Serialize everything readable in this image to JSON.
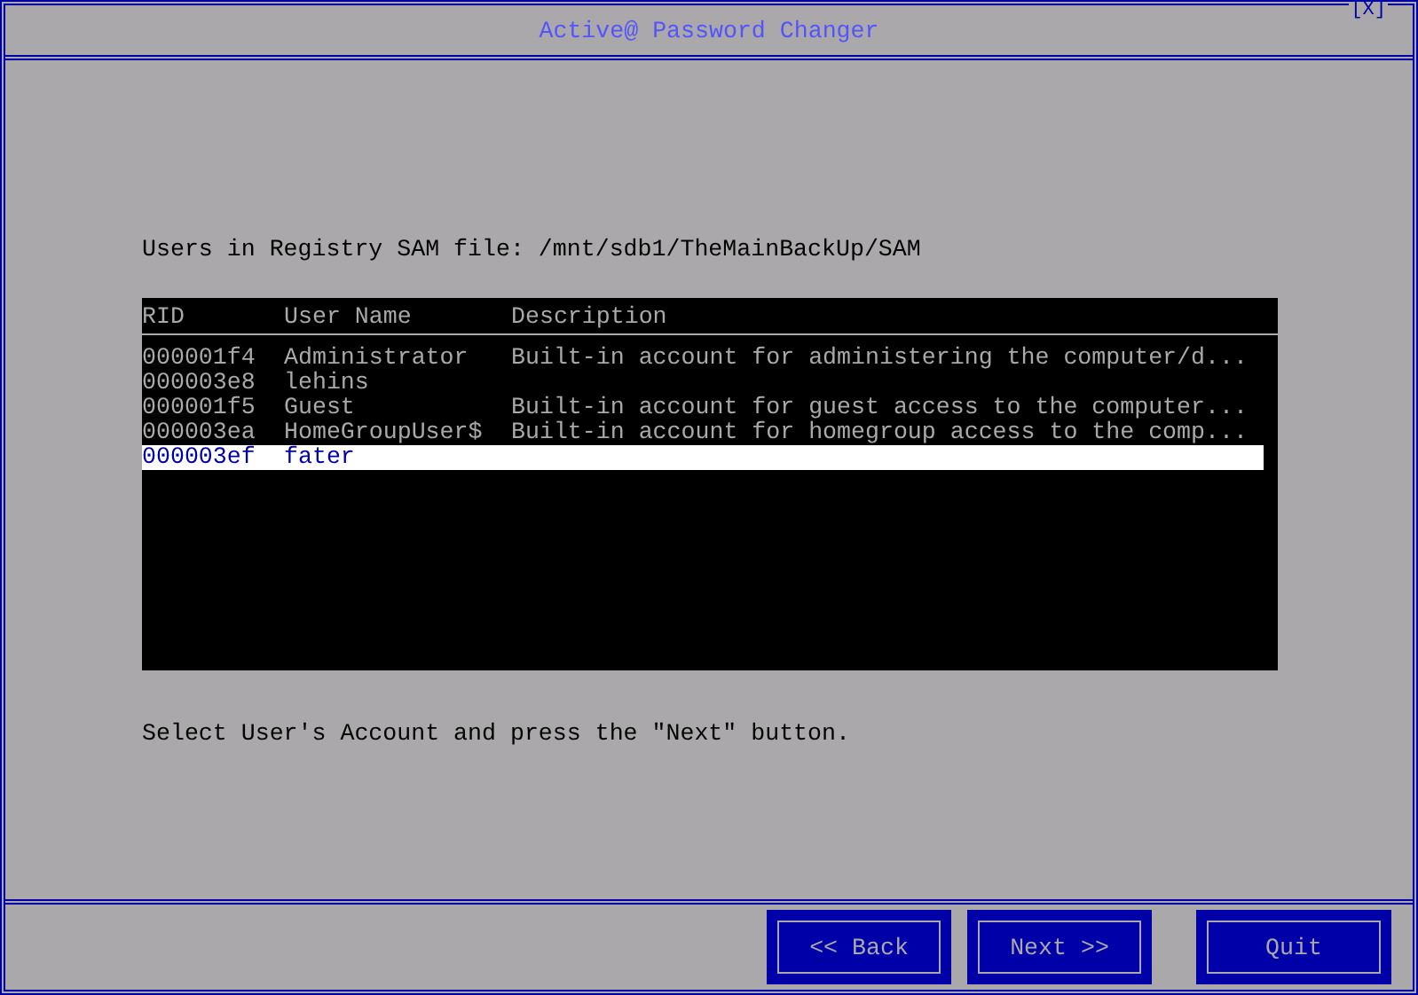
{
  "window": {
    "title": "Active@ Password Changer",
    "close_label": "[X]"
  },
  "prompt": "Users in Registry SAM file: /mnt/sdb1/TheMainBackUp/SAM",
  "table": {
    "columns": [
      "RID",
      "User Name",
      "Description"
    ],
    "rows": [
      {
        "rid": "000001f4",
        "user_name": "Administrator",
        "description": "Built-in account for administering the computer/d...",
        "selected": false
      },
      {
        "rid": "000003e8",
        "user_name": "lehins",
        "description": "",
        "selected": false
      },
      {
        "rid": "000001f5",
        "user_name": "Guest",
        "description": "Built-in account for guest access to the computer...",
        "selected": false
      },
      {
        "rid": "000003ea",
        "user_name": "HomeGroupUser$",
        "description": "Built-in account for homegroup access to the comp...",
        "selected": false
      },
      {
        "rid": "000003ef",
        "user_name": "fater",
        "description": "",
        "selected": true
      }
    ]
  },
  "instruction": "Select User's Account and press the \"Next\" button.",
  "buttons": [
    "<< Back",
    "Next >>",
    "Quit"
  ]
}
